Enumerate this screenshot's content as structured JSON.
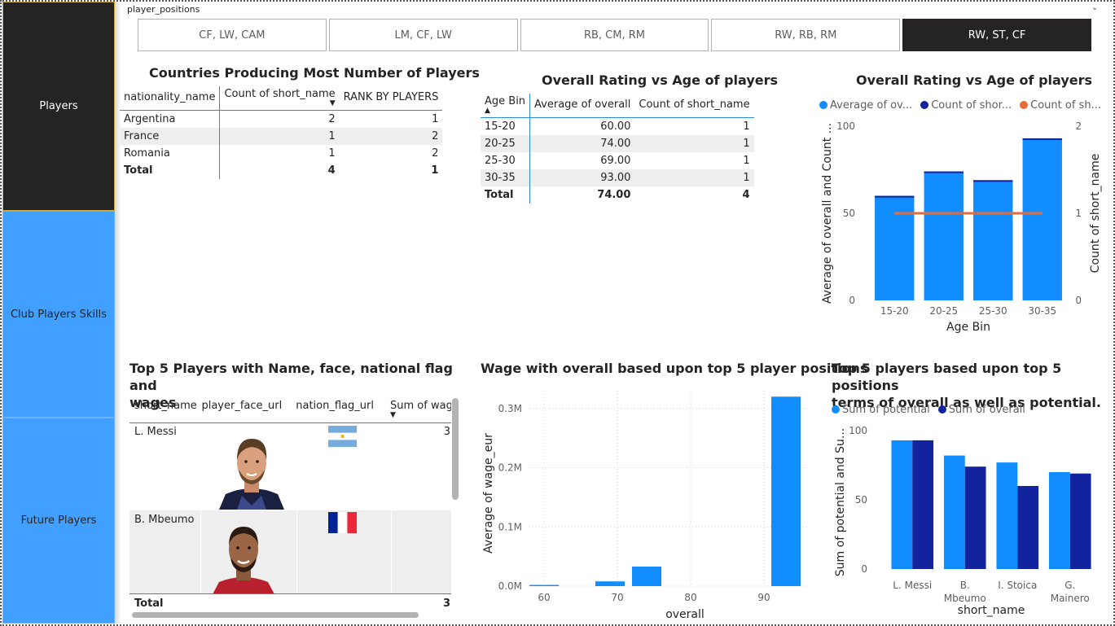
{
  "nav": {
    "items": [
      {
        "label": "Players",
        "active": true
      },
      {
        "label": "Club Players Skills",
        "active": false
      },
      {
        "label": "Future Players",
        "active": false
      }
    ]
  },
  "slicer": {
    "title": "player_positions",
    "options": [
      "CF, LW, CAM",
      "LM, CF, LW",
      "RB, CM, RM",
      "RW, RB, RM",
      "RW, ST, CF"
    ],
    "selected": "RW, ST, CF"
  },
  "countries_table": {
    "title": "Countries Producing Most Number of Players",
    "columns": [
      "nationality_name",
      "Count of short_name",
      "RANK BY PLAYERS"
    ],
    "rows": [
      [
        "Argentina",
        "2",
        "1"
      ],
      [
        "France",
        "1",
        "2"
      ],
      [
        "Romania",
        "1",
        "2"
      ]
    ],
    "total": [
      "Total",
      "4",
      "1"
    ]
  },
  "age_table": {
    "title": "Overall Rating vs Age of players",
    "columns": [
      "Age Bin",
      "Average of overall",
      "Count of short_name"
    ],
    "rows": [
      [
        "15-20",
        "60.00",
        "1"
      ],
      [
        "20-25",
        "74.00",
        "1"
      ],
      [
        "25-30",
        "69.00",
        "1"
      ],
      [
        "30-35",
        "93.00",
        "1"
      ]
    ],
    "total": [
      "Total",
      "74.00",
      "4"
    ]
  },
  "players_table": {
    "title_line1": "Top 5 Players with Name, face, national flag and",
    "title_line2": "wages",
    "columns": [
      "short_name",
      "player_face_url",
      "nation_flag_url",
      "Sum of wag"
    ],
    "rows": [
      {
        "name": "L. Messi",
        "wage": "3"
      },
      {
        "name": "B. Mbeumo",
        "wage": ""
      }
    ],
    "total_label": "Total",
    "total_value": "3"
  },
  "chart_data": [
    {
      "type": "bar",
      "title": "Overall Rating vs Age of players",
      "categories": [
        "15-20",
        "20-25",
        "25-30",
        "30-35"
      ],
      "series": [
        {
          "name": "Average of ov...",
          "values": [
            60,
            74,
            69,
            93
          ],
          "color": "#118dff"
        },
        {
          "name": "Count of shor...",
          "values": [
            1,
            1,
            1,
            1
          ],
          "color": "#12239e"
        },
        {
          "name": "Count of sh...",
          "values": [
            1,
            1,
            1,
            1
          ],
          "color": "#e66c37"
        }
      ],
      "xlabel": "Age Bin",
      "ylabel": "Average of overall and Count ...",
      "y2label": "Count of short_name",
      "ylim": [
        0,
        100
      ],
      "y2lim": [
        0,
        2
      ],
      "yticks": [
        "0",
        "50",
        "100"
      ],
      "y2ticks": [
        "0",
        "1",
        "2"
      ],
      "legend": "top"
    },
    {
      "type": "bar",
      "title": "Wage with overall based upon top 5 player positions",
      "x": [
        60,
        69,
        74,
        93
      ],
      "values": [
        2000,
        8000,
        33000,
        320000
      ],
      "xlabel": "overall",
      "ylabel": "Average of wage_eur",
      "xlim": [
        58,
        96
      ],
      "ylim": [
        0,
        330000
      ],
      "xticks": [
        "60",
        "70",
        "80",
        "90"
      ],
      "yticks": [
        "0.0M",
        "0.1M",
        "0.2M",
        "0.3M"
      ],
      "color": "#118dff",
      "grid": true
    },
    {
      "type": "bar",
      "title_line1": "Top 5 players based upon top 5 positions",
      "title_line2": "terms of overall as well as potential.",
      "categories": [
        "L. Messi",
        "B. Mbeumo",
        "I. Stoica",
        "G. Mainero"
      ],
      "category_lines": [
        [
          "L. Messi"
        ],
        [
          "B.",
          "Mbeumo"
        ],
        [
          "I. Stoica"
        ],
        [
          "G.",
          "Mainero"
        ]
      ],
      "series": [
        {
          "name": "Sum of potential",
          "values": [
            93,
            82,
            77,
            70
          ],
          "color": "#118dff"
        },
        {
          "name": "Sum of overall",
          "values": [
            93,
            74,
            60,
            69
          ],
          "color": "#12239e"
        }
      ],
      "xlabel": "short_name",
      "ylabel": "Sum of potential and Su...",
      "ylim": [
        0,
        100
      ],
      "yticks": [
        "0",
        "50",
        "100"
      ],
      "legend": "top-left"
    }
  ]
}
